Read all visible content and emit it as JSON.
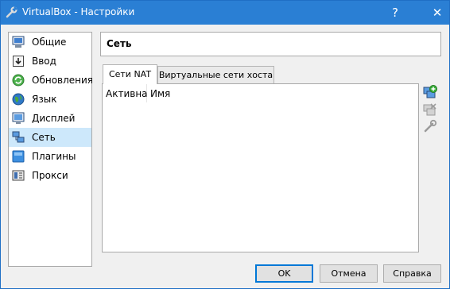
{
  "window": {
    "title": "VirtualBox - Настройки",
    "help_glyph": "?",
    "close_glyph": "✕",
    "title_icon": "virtualbox-settings-icon"
  },
  "sidebar": {
    "items": [
      {
        "label": "Общие",
        "icon": "monitor-icon"
      },
      {
        "label": "Ввод",
        "icon": "keyboard-icon"
      },
      {
        "label": "Обновления",
        "icon": "update-icon"
      },
      {
        "label": "Язык",
        "icon": "globe-icon"
      },
      {
        "label": "Дисплей",
        "icon": "display-icon"
      },
      {
        "label": "Сеть",
        "icon": "network-icon",
        "selected": true
      },
      {
        "label": "Плагины",
        "icon": "plugin-icon"
      },
      {
        "label": "Прокси",
        "icon": "proxy-icon"
      }
    ]
  },
  "section": {
    "title": "Сеть"
  },
  "tabs": [
    {
      "label": "Сети NAT",
      "active": true
    },
    {
      "label": "Виртуальные сети хоста",
      "active": false
    }
  ],
  "table": {
    "columns": [
      "Активна",
      "Имя"
    ],
    "rows": []
  },
  "tools": [
    {
      "icon": "add-network-icon",
      "enabled": true
    },
    {
      "icon": "remove-network-icon",
      "enabled": false
    },
    {
      "icon": "edit-network-icon",
      "enabled": false
    }
  ],
  "buttons": {
    "ok": "OK",
    "cancel": "Отмена",
    "help": "Справка"
  },
  "colors": {
    "titlebar": "#2a7fd4",
    "selection": "#cde8fb",
    "default_button_border": "#0078d7"
  }
}
